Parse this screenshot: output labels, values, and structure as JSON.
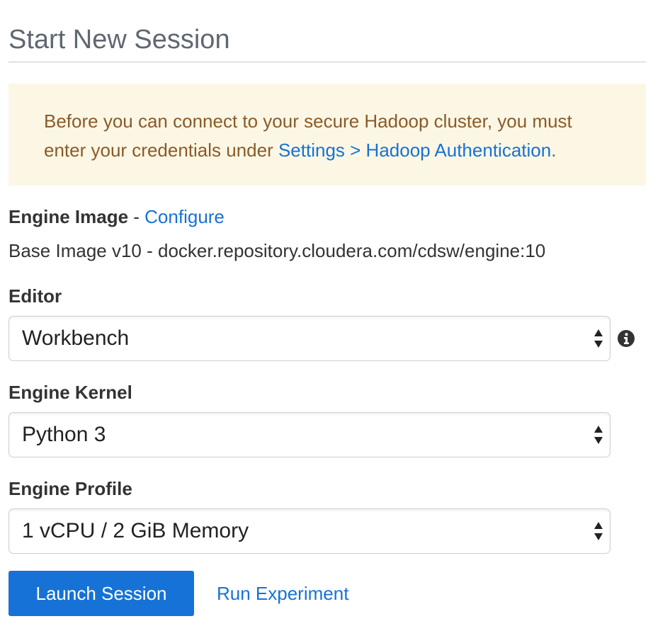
{
  "page": {
    "title": "Start New Session"
  },
  "alert": {
    "text_before": "Before you can connect to your secure Hadoop cluster, you must enter your credentials under ",
    "link_text": "Settings > Hadoop Authentication",
    "text_after": "."
  },
  "engine_image": {
    "label": "Engine Image",
    "separator": " - ",
    "configure_link": "Configure",
    "value": "Base Image v10 - docker.repository.cloudera.com/cdsw/engine:10"
  },
  "editor": {
    "label": "Editor",
    "selected": "Workbench",
    "info_icon": "info-circle-icon"
  },
  "engine_kernel": {
    "label": "Engine Kernel",
    "selected": "Python 3"
  },
  "engine_profile": {
    "label": "Engine Profile",
    "selected": "1 vCPU / 2 GiB Memory"
  },
  "actions": {
    "launch_label": "Launch Session",
    "experiment_label": "Run Experiment"
  },
  "colors": {
    "primary": "#1672d6",
    "alert_bg": "#fcf7e4",
    "alert_text": "#8a5a2a",
    "title_text": "#5f6771"
  }
}
